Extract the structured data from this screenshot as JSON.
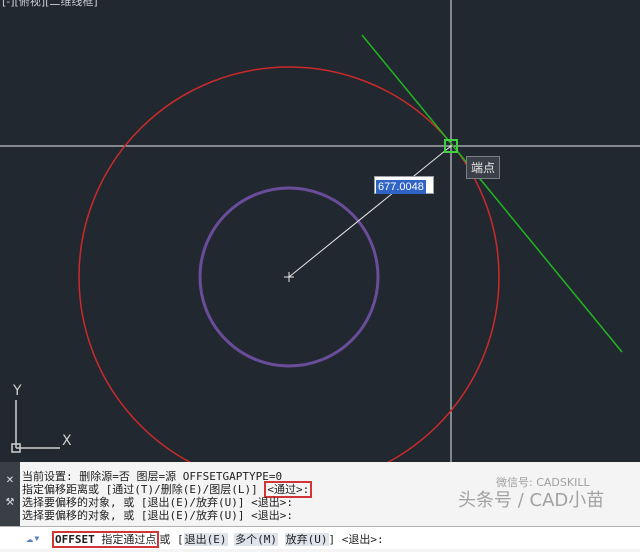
{
  "viewport": {
    "view_label": "[-][俯视][二维线框]",
    "dimension_value": "677.0048",
    "snap_tooltip": "端点",
    "ucs": {
      "y_label": "Y",
      "x_label": "X"
    }
  },
  "colors": {
    "canvas_bg": "#212830",
    "outer_circle": "#cc2a2a",
    "inner_circle": "#6a4d9a",
    "tangent_line": "#22b522",
    "crosshair": "#e8e8e8",
    "snap_marker": "#3fd13f",
    "highlight_box": "#d23535"
  },
  "command_history": {
    "lines": [
      {
        "prefix": "当前设置: 删除源=否  图层=源  OFFSETGAPTYPE=0",
        "boxed": ""
      },
      {
        "prefix": "指定偏移距离或 [通过(T)/删除(E)/图层(L)] ",
        "boxed": "<通过>:"
      },
      {
        "prefix": "选择要偏移的对象, 或 [退出(E)/放弃(U)] <退出>:",
        "boxed": ""
      },
      {
        "prefix": "选择要偏移的对象, 或 [退出(E)/放弃(U)] <退出>:",
        "boxed": ""
      }
    ]
  },
  "command_line": {
    "command": "OFFSET",
    "prompt": "指定通过点",
    "connector": "或",
    "options": [
      {
        "label": "退出(E)"
      },
      {
        "label": "多个(M)"
      },
      {
        "label": "放弃(U)"
      }
    ],
    "suffix": "<退出>:"
  },
  "watermark": {
    "line1": "微信号: CADSKILL",
    "line2": "头条号 / CAD小苗"
  }
}
